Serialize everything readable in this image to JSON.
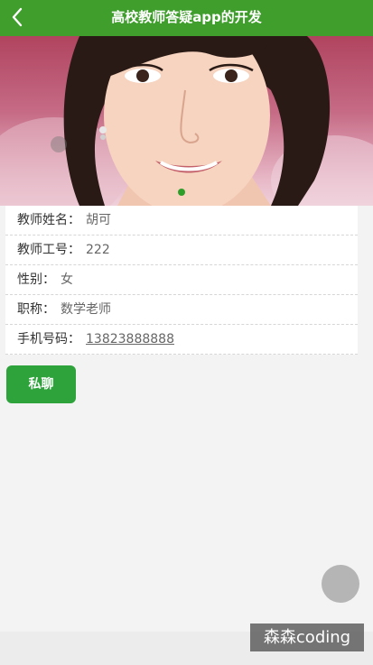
{
  "header": {
    "title": "高校教师答疑app的开发",
    "back_icon": "chevron-left-icon",
    "background_color": "#3f9e2c"
  },
  "banner": {
    "indicator_active_color": "#2e9e2a"
  },
  "teacher": {
    "fields": [
      {
        "label": "教师姓名：",
        "value": "胡可"
      },
      {
        "label": "教师工号：",
        "value": "222"
      },
      {
        "label": "性别：",
        "value": "女"
      },
      {
        "label": "职称：",
        "value": "数学老师"
      },
      {
        "label": "手机号码：",
        "value": "13823888888"
      }
    ]
  },
  "actions": {
    "chat_label": "私聊",
    "chat_color": "#2ea23b"
  },
  "watermark": {
    "text": "森森coding"
  }
}
